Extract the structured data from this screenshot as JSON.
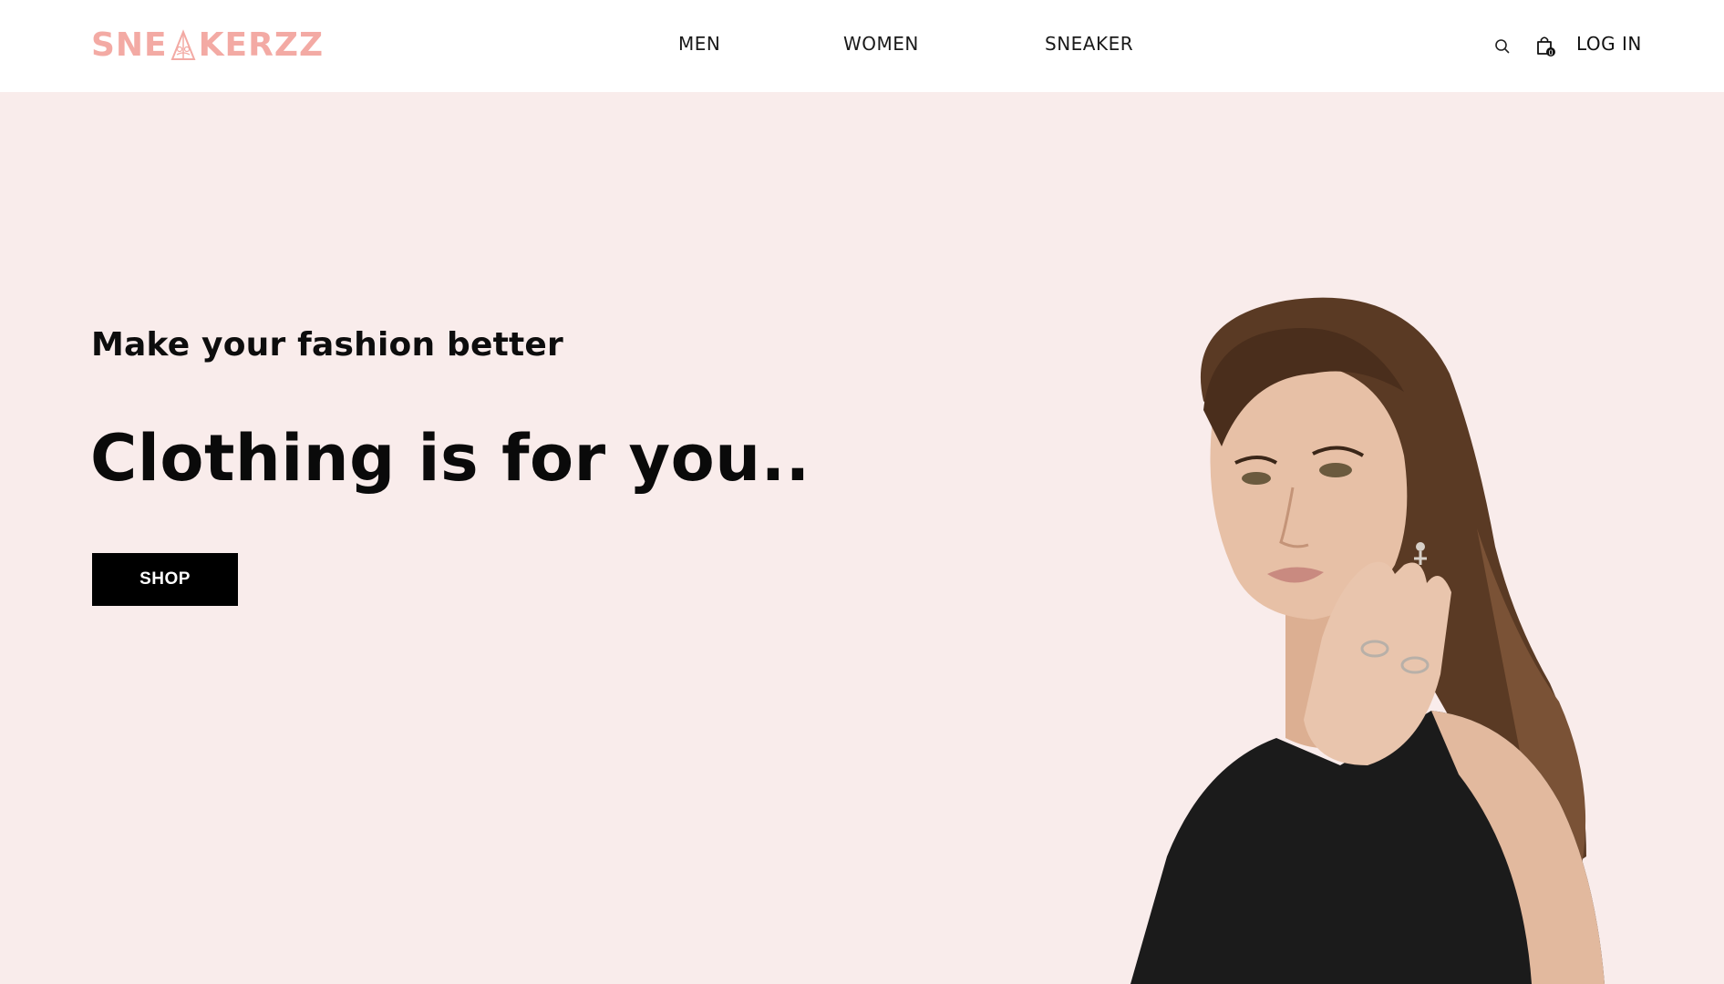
{
  "header": {
    "logo_text_left": "SNE",
    "logo_text_right": "KERZZ",
    "nav": [
      {
        "label": "MEN"
      },
      {
        "label": "WOMEN"
      },
      {
        "label": "SNEAKER"
      }
    ],
    "search_icon": "search-icon",
    "cart_icon": "shopping-bag-icon",
    "cart_count": "0",
    "login_label": "LOG IN"
  },
  "hero": {
    "subtitle": "Make your fashion better",
    "headline": "Clothing is for you..",
    "shop_label": "SHOP",
    "image": "woman-portrait-image"
  },
  "colors": {
    "background": "#f9eceb",
    "header": "#ffffff",
    "brand": "#f3aaa4",
    "button": "#000000",
    "button_text": "#ffffff"
  }
}
